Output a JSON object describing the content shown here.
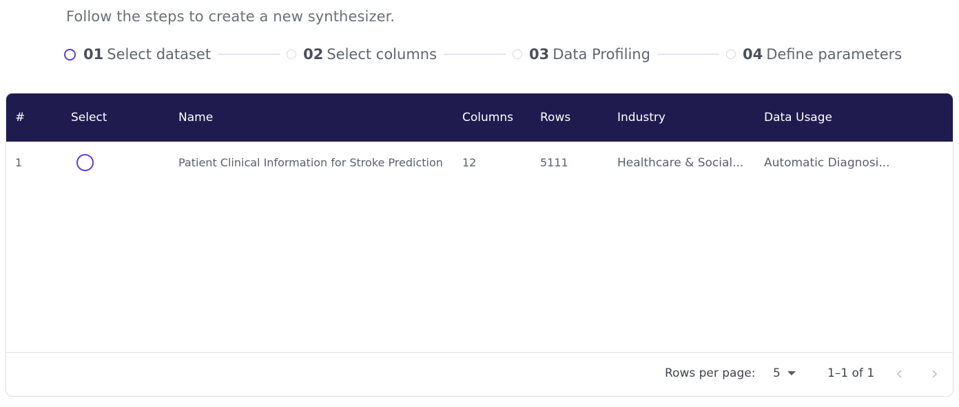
{
  "header": {
    "subtitle": "Follow the steps to create a new synthesizer."
  },
  "stepper": {
    "steps": [
      {
        "num": "01",
        "label": "Select dataset",
        "active": true
      },
      {
        "num": "02",
        "label": "Select columns",
        "active": false
      },
      {
        "num": "03",
        "label": "Data Profiling",
        "active": false
      },
      {
        "num": "04",
        "label": "Define parameters",
        "active": false
      }
    ]
  },
  "table": {
    "columns": [
      "#",
      "Select",
      "Name",
      "Columns",
      "Rows",
      "Industry",
      "Data Usage"
    ],
    "rows": [
      {
        "index": "1",
        "name": "Patient Clinical Information for Stroke Prediction",
        "columns": "12",
        "rows": "5111",
        "industry": "Healthcare & Social...",
        "data_usage": "Automatic Diagnosi..."
      }
    ]
  },
  "pagination": {
    "rows_per_page_label": "Rows per page:",
    "rows_per_page_value": "5",
    "page_info": "1–1 of 1"
  },
  "colors": {
    "accent": "#5a3fd6",
    "header_bg": "#1f1b4f"
  },
  "icons": {
    "prev": "chevron-left-icon",
    "next": "chevron-right-icon",
    "dropdown": "caret-down-icon"
  }
}
